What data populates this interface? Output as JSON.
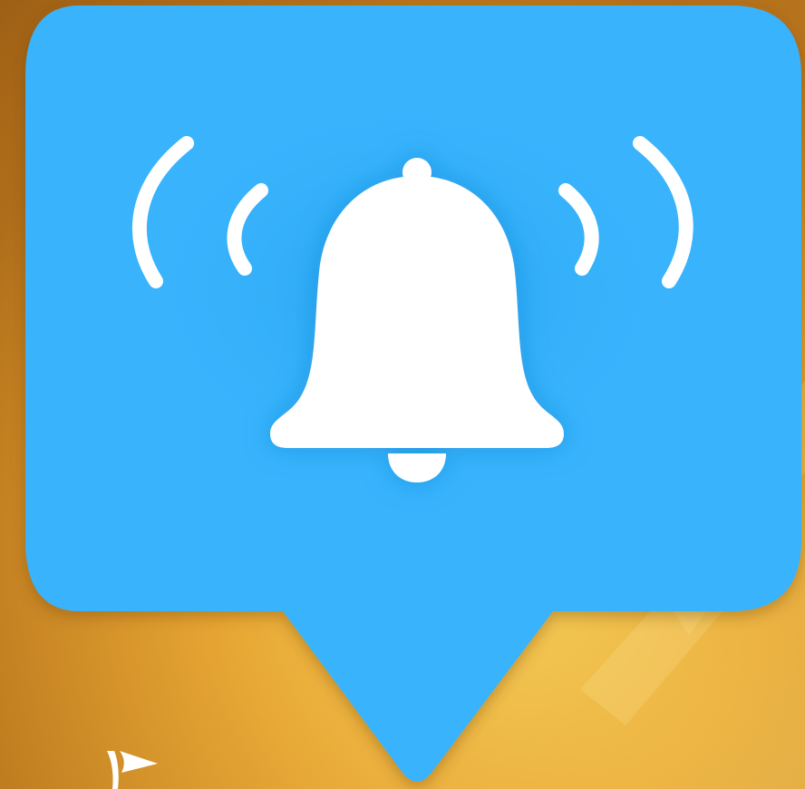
{
  "image": {
    "subject": "notification-bell-icon",
    "background_colors": [
      "#b8741c",
      "#e7a531",
      "#f6c64a",
      "#c98520"
    ],
    "bubble_color": "#37b3fc",
    "bubble_shadow_color": "#2a8fd0",
    "bell_color": "#ffffff",
    "glow_color": "#1f9ee8",
    "corner_mark_icon": "flag-logo-icon"
  }
}
